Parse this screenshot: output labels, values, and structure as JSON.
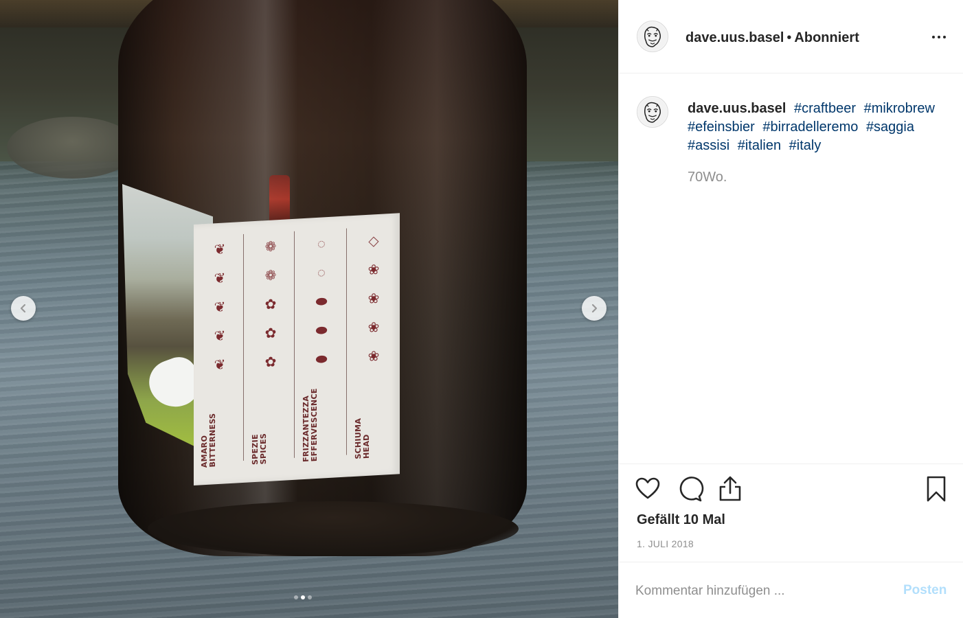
{
  "media": {
    "label_columns": [
      {
        "line1": "AMARO",
        "line2": "BITTERNESS",
        "icon": "wheat-icon",
        "filled": 5,
        "total": 5
      },
      {
        "line1": "SPEZIE",
        "line2": "SPICES",
        "icon": "hop-icon",
        "filled": 3,
        "total": 5
      },
      {
        "line1": "FRIZZANTEZZA",
        "line2": "EFFERVESCENCE",
        "icon": "bubbles-icon",
        "filled": 3,
        "total": 5
      },
      {
        "line1": "SCHIUMA",
        "line2": "HEAD",
        "icon": "foam-icon",
        "filled": 4,
        "total": 5
      }
    ],
    "carousel": {
      "current": 2,
      "total": 3
    }
  },
  "header": {
    "username": "dave.uus.basel",
    "separator": "•",
    "follow_status": "Abonniert"
  },
  "caption": {
    "username": "dave.uus.basel",
    "hashtags": [
      "#craftbeer",
      "#mikrobrew",
      "#efeinsbier",
      "#birradelleremo",
      "#saggia",
      "#assisi",
      "#italien",
      "#italy"
    ],
    "time_ago": "70Wo."
  },
  "actions": {
    "likes": "Gefällt 10 Mal",
    "date": "1. JULI 2018"
  },
  "comment": {
    "placeholder": "Kommentar hinzufügen ...",
    "post_label": "Posten"
  },
  "colors": {
    "hashtag": "#00376b",
    "post_disabled": "#b2dffc",
    "muted": "#8e8e8e",
    "label_ink": "#7b2a2e"
  }
}
